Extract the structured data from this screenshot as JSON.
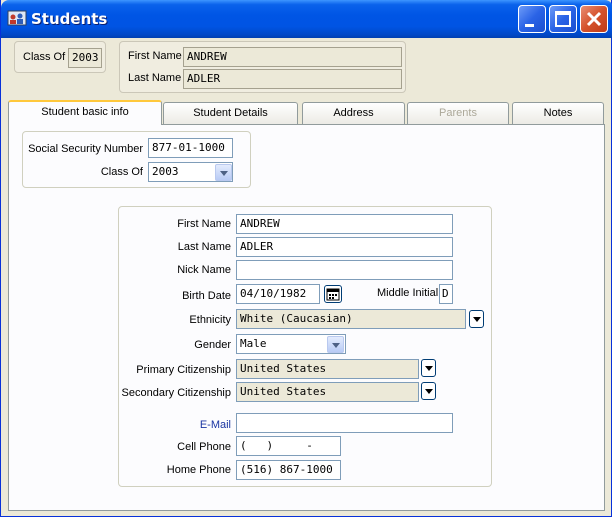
{
  "window": {
    "title": "Students"
  },
  "header": {
    "class_of_label": "Class Of",
    "class_of_value": "2003",
    "first_name_label": "First Name",
    "first_name_value": "ANDREW",
    "last_name_label": "Last Name",
    "last_name_value": "ADLER"
  },
  "tabs": [
    {
      "label": "Student basic info",
      "active": true,
      "enabled": true
    },
    {
      "label": "Student Details",
      "active": false,
      "enabled": true
    },
    {
      "label": "Address",
      "active": false,
      "enabled": true
    },
    {
      "label": "Parents",
      "active": false,
      "enabled": false
    },
    {
      "label": "Notes",
      "active": false,
      "enabled": true
    }
  ],
  "basic": {
    "ssn_label": "Social Security Number",
    "ssn_value": "877-01-1000",
    "class_of_label": "Class Of",
    "class_of_value": "2003"
  },
  "details": {
    "first_name_label": "First Name",
    "first_name_value": "ANDREW",
    "last_name_label": "Last Name",
    "last_name_value": "ADLER",
    "nick_name_label": "Nick Name",
    "nick_name_value": "",
    "birth_date_label": "Birth Date",
    "birth_date_value": "04/10/1982",
    "middle_initial_label": "Middle Initial",
    "middle_initial_value": "D",
    "ethnicity_label": "Ethnicity",
    "ethnicity_value": "White (Caucasian)",
    "gender_label": "Gender",
    "gender_value": "Male",
    "primary_citizenship_label": "Primary Citizenship",
    "primary_citizenship_value": "United States",
    "secondary_citizenship_label": "Secondary Citizenship",
    "secondary_citizenship_value": "United States",
    "email_label": "E-Mail",
    "email_value": "",
    "cell_phone_label": "Cell Phone",
    "cell_phone_value": "(   )     -",
    "home_phone_label": "Home Phone",
    "home_phone_value": "(516) 867-1000"
  },
  "colors": {
    "title_bar": "#0054e3",
    "active_tab_accent": "#ffc83c",
    "email_label": "#1a35a3"
  },
  "icons": {
    "app": "students-app-icon",
    "minimize": "minimize-icon",
    "maximize": "maximize-icon",
    "close": "close-icon",
    "calendar": "calendar-icon"
  }
}
